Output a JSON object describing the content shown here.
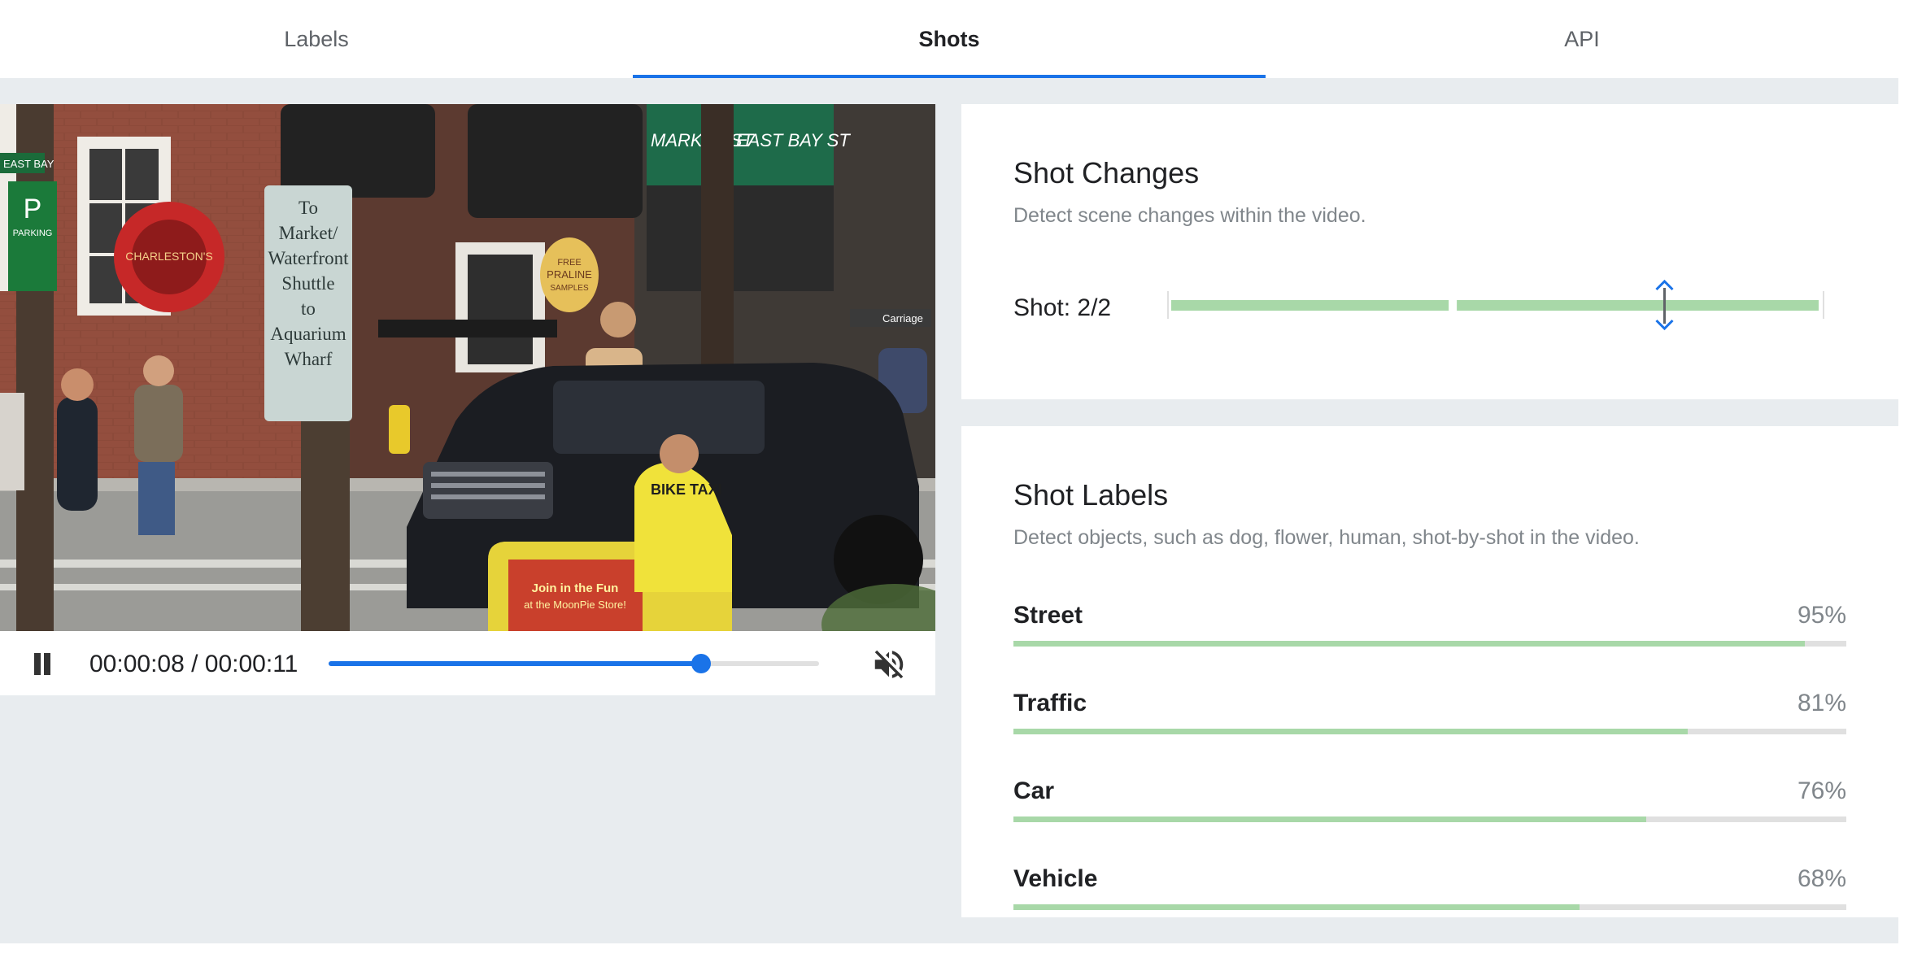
{
  "tabs": [
    {
      "label": "Labels",
      "active": false
    },
    {
      "label": "Shots",
      "active": true
    },
    {
      "label": "API",
      "active": false
    }
  ],
  "player": {
    "state": "playing",
    "pause_icon": "pause-icon",
    "time_display": "00:00:08 / 00:00:11",
    "progress_fraction": 0.76,
    "muted": true,
    "mute_icon": "volume-off-icon",
    "scene_signs": {
      "bus_sign": [
        "To",
        "Market/",
        "Waterfront",
        "Shuttle",
        "to",
        "Aquarium",
        "Wharf"
      ],
      "parking_sign": [
        "P",
        "PARKING"
      ],
      "street_sign_left": "EAST BAY",
      "store_sign": "CHARLESTON'S",
      "awning": [
        "MARKET ST",
        "EAST BAY ST"
      ],
      "praline_sign": [
        "FREE",
        "PRALINE",
        "SAMPLES"
      ],
      "carriage_sign": "Carriage",
      "taxi_shirt": "BIKE TAXI",
      "taxi_ad": [
        "Join in the Fun",
        "at the MoonPie Store!"
      ]
    }
  },
  "shot_changes": {
    "title": "Shot Changes",
    "subtitle": "Detect scene changes within the video.",
    "shot_text": "Shot: 2/2",
    "segments_fraction": [
      [
        0,
        0.43
      ],
      [
        0.44,
        1.0
      ]
    ],
    "marker_fraction": 0.76,
    "marker_icon": "expand-vertical-icon",
    "colors": {
      "segment": "#a8d8a8",
      "marker": "#1a73e8"
    }
  },
  "shot_labels": {
    "title": "Shot Labels",
    "subtitle": "Detect objects, such as dog, flower, human, shot-by-shot in the video.",
    "items": [
      {
        "name": "Street",
        "percent_text": "95%",
        "value": 0.95
      },
      {
        "name": "Traffic",
        "percent_text": "81%",
        "value": 0.81
      },
      {
        "name": "Car",
        "percent_text": "76%",
        "value": 0.76
      },
      {
        "name": "Vehicle",
        "percent_text": "68%",
        "value": 0.68
      }
    ],
    "colors": {
      "bar": "#a8d8a8",
      "track": "#e0e0e0"
    }
  }
}
